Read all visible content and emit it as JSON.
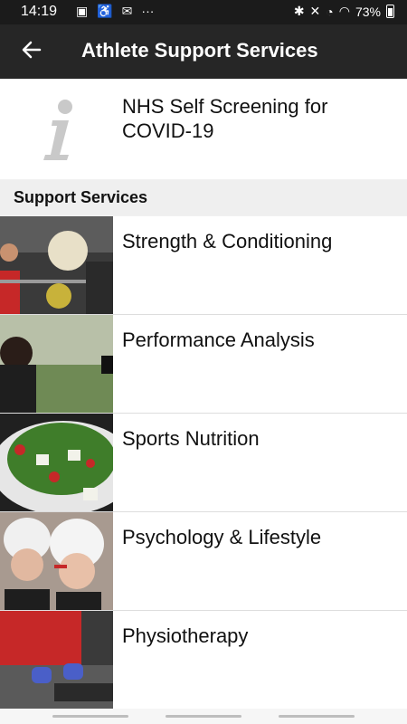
{
  "status": {
    "time": "14:19",
    "battery": "73%"
  },
  "appbar": {
    "title": "Athlete Support Services"
  },
  "info": {
    "label": "NHS Self Screening for COVID-19"
  },
  "section": {
    "header": "Support Services"
  },
  "services": [
    {
      "label": "Strength & Conditioning"
    },
    {
      "label": "Performance Analysis"
    },
    {
      "label": "Sports Nutrition"
    },
    {
      "label": "Psychology & Lifestyle"
    },
    {
      "label": "Physiotherapy"
    }
  ],
  "colors": {
    "statusbar": "#1b1b1b",
    "appbar": "#262626",
    "section_bg": "#efefef",
    "text": "#111111"
  },
  "icons": [
    "photo-icon",
    "accessibility-icon",
    "voicemail-icon",
    "more-dots-icon",
    "bluetooth-icon",
    "mute-icon",
    "alarm-icon",
    "wifi-icon",
    "battery-icon",
    "back-arrow-icon",
    "info-icon"
  ]
}
